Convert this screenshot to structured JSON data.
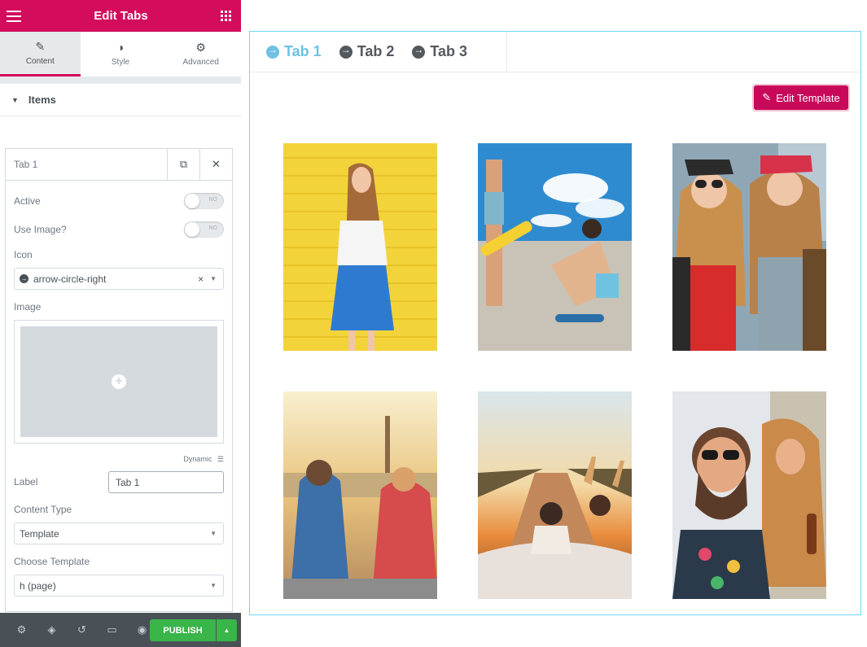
{
  "panel": {
    "title": "Edit Tabs",
    "tabs": [
      {
        "label": "Content",
        "icon": "pencil-icon"
      },
      {
        "label": "Style",
        "icon": "half-circle-icon"
      },
      {
        "label": "Advanced",
        "icon": "gear-icon"
      }
    ],
    "section_title": "Items",
    "repeater": {
      "item_title": "Tab 1",
      "active_label": "Active",
      "active_value": "NO",
      "use_image_label": "Use Image?",
      "use_image_value": "NO",
      "icon_label": "Icon",
      "icon_value": "arrow-circle-right",
      "image_label": "Image",
      "dynamic_label": "Dynamic",
      "label_label": "Label",
      "label_value": "Tab 1",
      "content_type_label": "Content Type",
      "content_type_value": "Template",
      "choose_template_label": "Choose Template",
      "choose_template_value": "h (page)"
    },
    "publish_label": "PUBLISH"
  },
  "preview": {
    "tabs": [
      {
        "label": "Tab 1",
        "active": true
      },
      {
        "label": "Tab 2",
        "active": false
      },
      {
        "label": "Tab 3",
        "active": false
      }
    ],
    "edit_template_label": "Edit Template"
  },
  "colors": {
    "brand": "#d30c5c",
    "accent": "#6ec1e4",
    "publish": "#39b54a"
  }
}
